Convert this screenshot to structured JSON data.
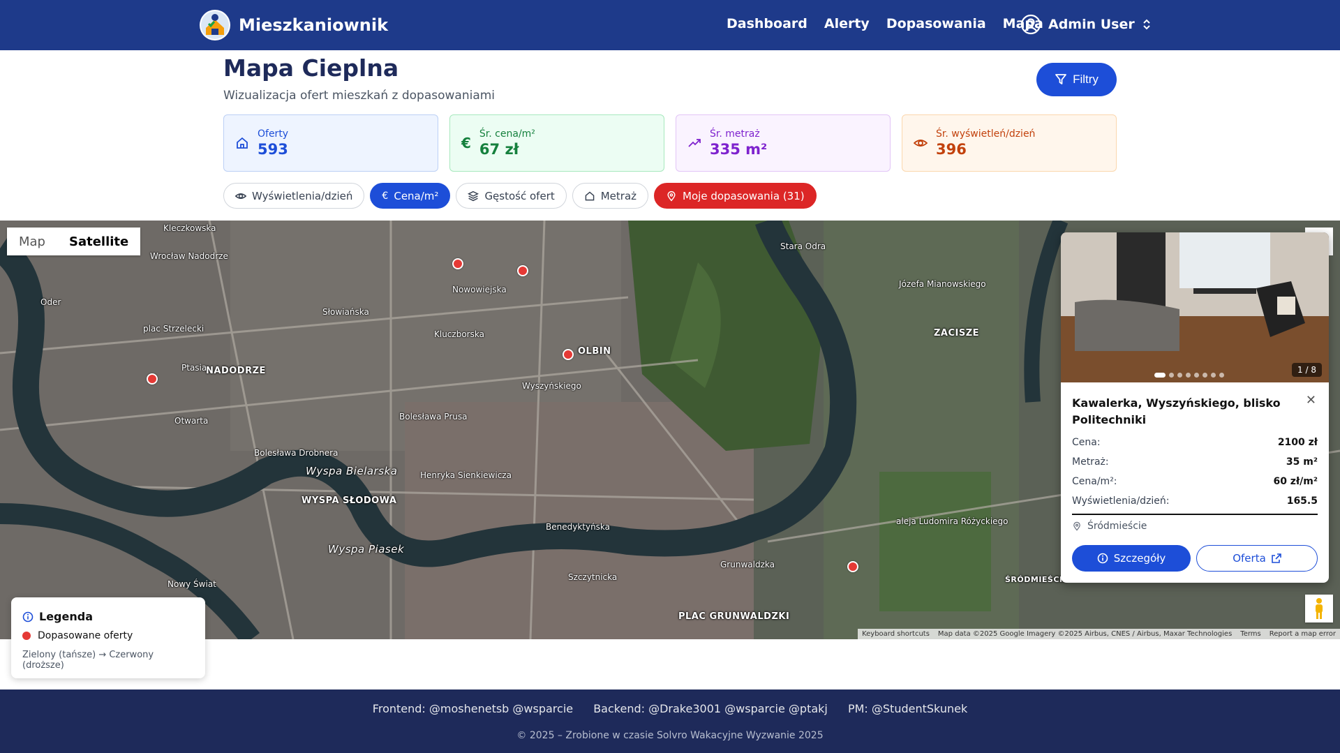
{
  "nav": {
    "brand": "Mieszkaniownik",
    "links": [
      "Dashboard",
      "Alerty",
      "Dopasowania",
      "Mapa"
    ],
    "user": "Admin User"
  },
  "header": {
    "title": "Mapa Cieplna",
    "subtitle": "Wizualizacja ofert mieszkań z dopasowaniami",
    "filter_label": "Filtry"
  },
  "stats": [
    {
      "label": "Oferty",
      "value": "593",
      "icon": "home-icon"
    },
    {
      "label": "Śr. cena/m²",
      "value": "67 zł",
      "icon": "euro-icon"
    },
    {
      "label": "Śr. metraż",
      "value": "335 m²",
      "icon": "trend-up-icon"
    },
    {
      "label": "Śr. wyświetleń/dzień",
      "value": "396",
      "icon": "eye-icon"
    }
  ],
  "toggles": [
    {
      "label": "Wyświetlenia/dzień",
      "icon": "eye-icon",
      "state": "inactive"
    },
    {
      "label": "Cena/m²",
      "icon": "euro-icon",
      "state": "active"
    },
    {
      "label": "Gęstość ofert",
      "icon": "layers-icon",
      "state": "inactive"
    },
    {
      "label": "Metraż",
      "icon": "home-icon",
      "state": "inactive"
    },
    {
      "label": "Moje dopasowania (31)",
      "icon": "map-pin-icon",
      "state": "highlight"
    }
  ],
  "map": {
    "type_options": [
      "Map",
      "Satellite"
    ],
    "selected_type": "Satellite",
    "labels": [
      "NADODRZE",
      "OLBIN",
      "ZACISZE",
      "WYSPA SŁODOWA",
      "PLAC GRUNWALDZKI",
      "ŚRÓDMIEŚCIE",
      "Wyspa Bielarska",
      "Wyspa Piasek"
    ],
    "streets": [
      "Kleczkowska",
      "Wrocław Nadodrze",
      "plac Strzelecki",
      "Słowiańska",
      "Nowowiejska",
      "Kluczborska",
      "Bolesława Prusa",
      "Henryka Sienkiewicza",
      "Bolesława Drobnera",
      "Benedyktyńska",
      "Szczytnicka",
      "Grunwaldzka",
      "Stara Odra",
      "aleja Ludomira Różyckiego",
      "Józefa Mianowskiego",
      "Oder",
      "Nowy Świat",
      "Otwarta",
      "Ptasia",
      "Wyszyńskiego"
    ],
    "attribution": [
      "Keyboard shortcuts",
      "Map data ©2025 Google Imagery ©2025 Airbus, CNES / Airbus, Maxar Technologies",
      "Terms",
      "Report a map error"
    ],
    "marker_color": "#e53935"
  },
  "popup": {
    "photo_counter": "1 / 8",
    "title": "Kawalerka, Wyszyńskiego, blisko Politechniki",
    "rows": [
      {
        "k": "Cena:",
        "v": "2100 zł"
      },
      {
        "k": "Metraż:",
        "v": "35 m²"
      },
      {
        "k": "Cena/m²:",
        "v": "60 zł/m²"
      },
      {
        "k": "Wyświetlenia/dzień:",
        "v": "165.5"
      }
    ],
    "location": "Śródmieście",
    "details_label": "Szczegóły",
    "offer_label": "Oferta"
  },
  "legend": {
    "title": "Legenda",
    "item": "Dopasowane oferty",
    "note": "Zielony (tańsze) → Czerwony (droższe)"
  },
  "footer": {
    "credits": [
      "Frontend: @moshenetsb @wsparcie",
      "Backend: @Drake3001 @wsparcie @ptakj",
      "PM: @StudentSkunek"
    ],
    "copyright": "© 2025 – Zrobione w czasie Solvro Wakacyjne Wyzwanie 2025"
  }
}
